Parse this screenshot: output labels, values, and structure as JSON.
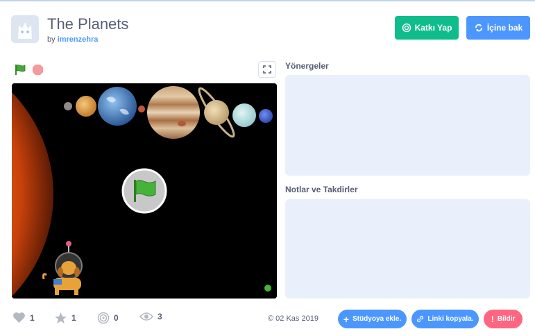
{
  "project": {
    "title": "The Planets",
    "by_label": "by",
    "author": "imrenzehra"
  },
  "header_buttons": {
    "remix_label": "Katkı Yap",
    "see_inside_label": "İçine bak"
  },
  "sections": {
    "instructions_title": "Yönergeler",
    "notes_title": "Notlar ve Takdirler"
  },
  "stats": {
    "loves": "1",
    "favorites": "1",
    "remixes": "0",
    "views": "3"
  },
  "footer": {
    "date": "02 Kas 2019",
    "add_to_studio": "Stüdyoya ekle.",
    "copy_link": "Linki kopyala.",
    "report": "Bildir"
  },
  "colors": {
    "green": "#0fbd8c",
    "blue": "#4c97ff",
    "red": "#ff6680",
    "text": "#575e75"
  }
}
